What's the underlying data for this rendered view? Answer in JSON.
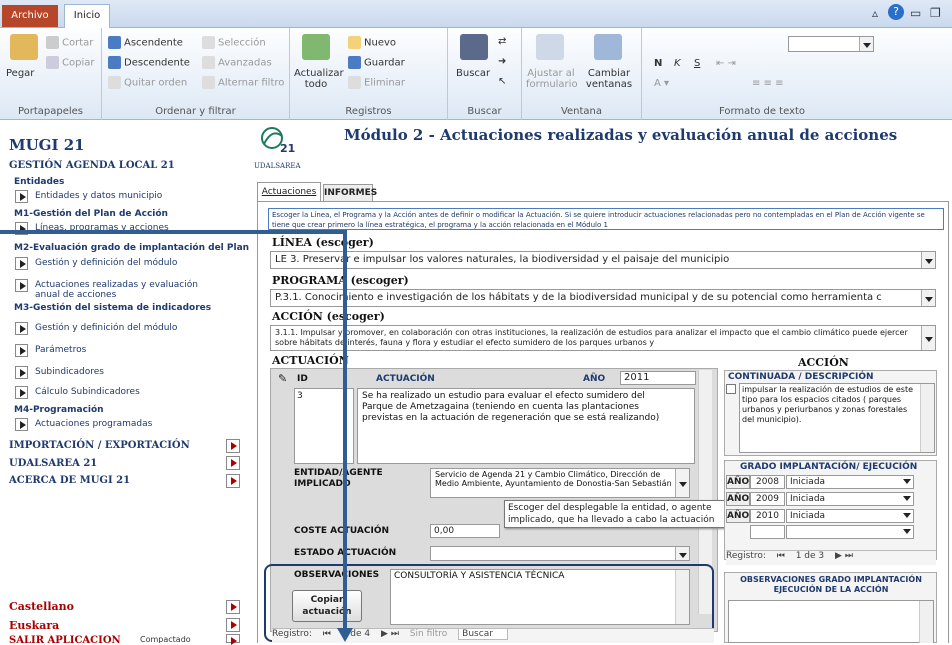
{
  "ribbon": {
    "tabs": [
      "Archivo",
      "Inicio"
    ],
    "groups": {
      "portapapeles": {
        "label": "Portapapeles",
        "paste": "Pegar",
        "cut": "Cortar",
        "copy": "Copiar"
      },
      "ordenar": {
        "label": "Ordenar y filtrar",
        "asc": "Ascendente",
        "desc": "Descendente",
        "remove": "Quitar orden",
        "selection": "Selección",
        "advanced": "Avanzadas",
        "toggle": "Alternar filtro"
      },
      "registros": {
        "label": "Registros",
        "refresh": "Actualizar todo",
        "new": "Nuevo",
        "save": "Guardar",
        "delete": "Eliminar"
      },
      "buscar": {
        "label": "Buscar",
        "find": "Buscar"
      },
      "ventana": {
        "label": "Ventana",
        "fit": "Ajustar al formulario",
        "switch": "Cambiar ventanas"
      },
      "formato": {
        "label": "Formato de texto",
        "bold": "N",
        "italic": "K",
        "underline": "S"
      }
    }
  },
  "sidebar": {
    "title": "MUGI 21",
    "subtitle": "GESTIÓN AGENDA LOCAL 21",
    "s1": "Entidades",
    "i1": "Entidades y datos municipio",
    "s2": "M1-Gestión del Plan de Acción",
    "i2": "Líneas, programas y acciones",
    "s3": "M2-Evaluación grado de implantación del Plan",
    "i3": "Gestión y definición del módulo",
    "i4": "Actuaciones realizadas y evaluación anual de acciones",
    "s4": "M3-Gestión del sistema de indicadores",
    "i5": "Gestión y definición del módulo",
    "i6": "Parámetros",
    "i7": "Subindicadores",
    "i8": "Cálculo Subindicadores",
    "s5": "M4-Programación",
    "i9": "Actuaciones programadas",
    "h1": "IMPORTACIÓN / EXPORTACIÓN",
    "h2": "UDALSAREA 21",
    "h3": "ACERCA DE MUGI 21",
    "lang1": "Castellano",
    "lang2": "Euskara",
    "exit": "SALIR APLICACIÓN",
    "compact": "Compactado"
  },
  "main": {
    "logo": "UDALSAREA",
    "logo_num": "21",
    "title": "Módulo 2 - Actuaciones realizadas y evaluación anual de acciones",
    "tab1": "Actuaciones",
    "tab2": "INFORMES",
    "notice": "Escoger la Línea, el Programa y la Acción antes de definir o modificar la Actuación. Si se quiere introducir actuaciones relacionadas pero no contempladas en el Plan de Acción vigente se tiene que crear primero la línea estratégica, el programa y la acción relacionada en el Módulo 1",
    "linea_lbl": "LÍNEA (escoger)",
    "linea_val": "LE 3. Preservar e impulsar los valores naturales, la biodiversidad y el paisaje del municipio",
    "prog_lbl": "PROGRAMA (escoger)",
    "prog_val": "P.3.1. Conocimiento e investigación de los hábitats y de la biodiversidad municipal  y de su potencial como herramienta c",
    "accion_lbl": "ACCIÓN (escoger)",
    "accion_val": "3.1.1. Impulsar y promover, en colaboración con otras instituciones, la realización de estudios para analizar el impacto que el cambio climático puede ejercer sobre hábitats de interés, fauna y flora y estudiar el efecto sumidero de los parques urbanos y",
    "actuacion_lbl": "ACTUACIÓN",
    "col_id": "ID",
    "col_act": "ACTUACIÓN",
    "col_year": "AÑO",
    "year_val": "2011",
    "id_val": "3",
    "act_text": "Se ha realizado un estudio para evaluar el efecto sumidero del Parque de Ametzagaina (teniendo en cuenta las plantaciones previstas en la actuación de regeneración que se está realizando)",
    "entidad_lbl": "ENTIDAD/AGENTE IMPLICADO",
    "entidad_val": "Servicio de Agenda 21 y Cambio Climático, Dirección de Medio Ambiente, Ayuntamiento de Donostia-San Sebastián",
    "tooltip": "Escoger del desplegable la entidad, o agente implicado, que ha llevado a cabo la actuación",
    "coste_lbl": "COSTE ACTUACIÓN",
    "coste_val": "0,00",
    "estado_lbl": "ESTADO ACTUACIÓN",
    "obs_lbl": "OBSERVACIONES",
    "obs_val": "CONSULTORÍA Y ASISTENCIA TÉCNICA",
    "copy_btn": "Copiar actuación",
    "nav_bottom": {
      "label": "Registro:",
      "pos": "3 de 4",
      "filter": "Sin filtro",
      "search": "Buscar"
    },
    "accion_title": "ACCIÓN",
    "cont_hdr": "CONTINUADA / DESCRIPCIÓN",
    "cont_text": "impulsar la realización de estudios de este tipo para los espacios citados ( parques urbanos y periurbanos y zonas forestales del municipio).",
    "grado_hdr": "GRADO IMPLANTACIÓN/ EJECUCIÓN",
    "grado_rows": [
      {
        "ab": "AÑO",
        "year": "2008",
        "st": "Iniciada"
      },
      {
        "ab": "AÑO",
        "year": "2009",
        "st": "Iniciada"
      },
      {
        "ab": "AÑO",
        "year": "2010",
        "st": "Iniciada"
      }
    ],
    "nav_right": {
      "label": "Registro:",
      "pos": "1 de 3"
    },
    "obs_grado_hdr": "OBSERVACIONES GRADO IMPLANTACIÓN EJECUCIÓN DE LA ACCIÓN"
  },
  "colors": {
    "accent": "#1f5f9e",
    "title": "#1f3a6e",
    "file_tab": "#b7472a"
  }
}
